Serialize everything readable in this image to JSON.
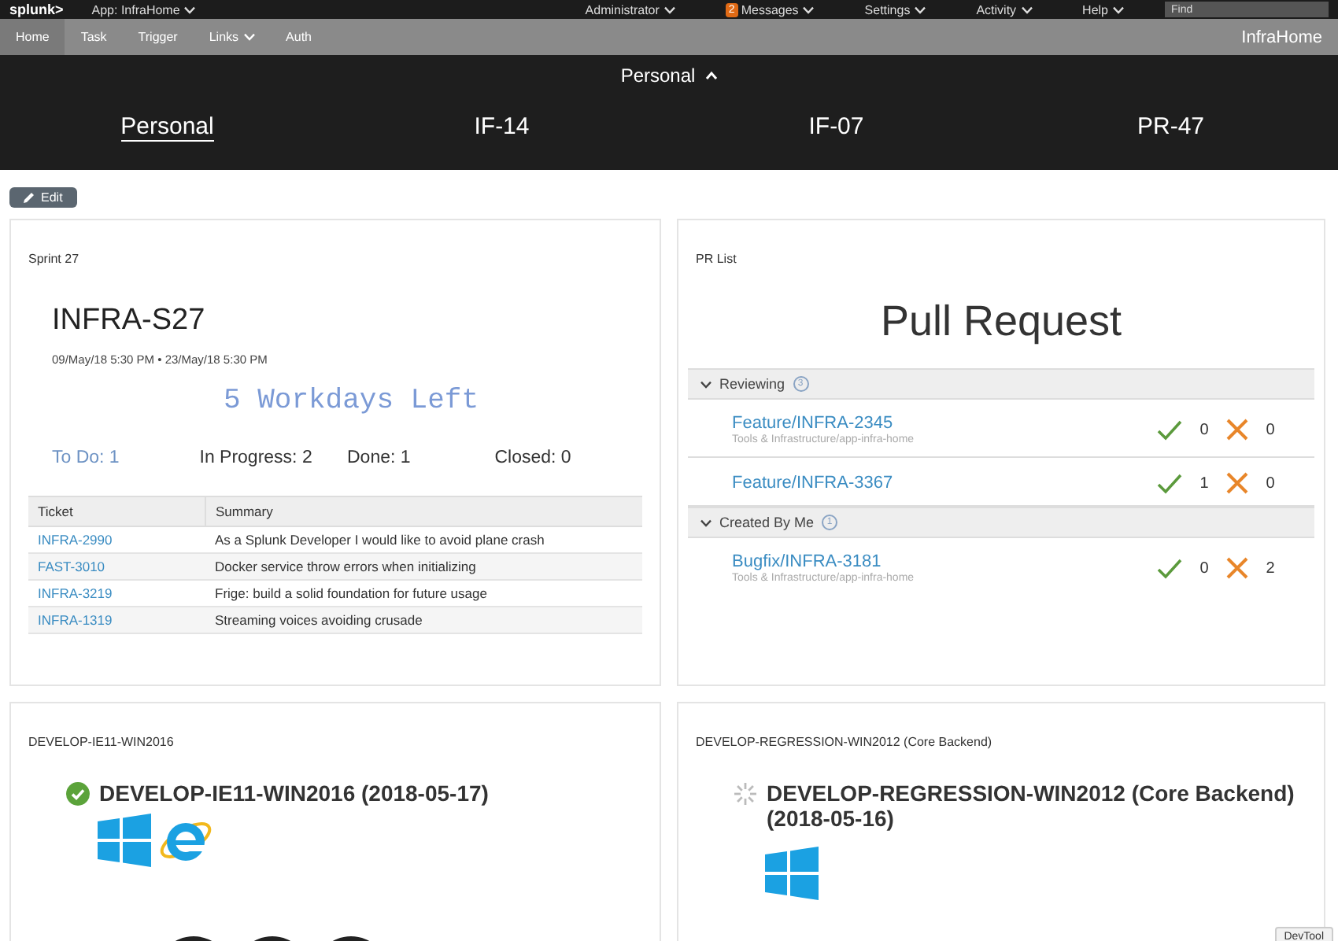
{
  "top_bar": {
    "logo": "splunk>",
    "app": {
      "label": "App: InfraHome",
      "dropdown": true
    },
    "menus": [
      {
        "label": "Administrator"
      },
      {
        "label": "Messages",
        "badge": "2"
      },
      {
        "label": "Settings"
      },
      {
        "label": "Activity"
      },
      {
        "label": "Help"
      }
    ],
    "search": {
      "placeholder": "Find"
    }
  },
  "app_bar": {
    "items": [
      {
        "label": "Home",
        "selected": true,
        "dropdown": false
      },
      {
        "label": "Task",
        "selected": false,
        "dropdown": false
      },
      {
        "label": "Trigger",
        "selected": false,
        "dropdown": false
      },
      {
        "label": "Links",
        "selected": false,
        "dropdown": true
      },
      {
        "label": "Auth",
        "selected": false,
        "dropdown": false
      }
    ],
    "app_title": "InfraHome"
  },
  "header": {
    "title": "Personal",
    "expanded": true,
    "tabs": [
      {
        "label": "Personal",
        "selected": true
      },
      {
        "label": "IF-14",
        "selected": false
      },
      {
        "label": "IF-07",
        "selected": false
      },
      {
        "label": "PR-47",
        "selected": false
      }
    ]
  },
  "edit_button": "Edit",
  "sprint": {
    "panel_title": "Sprint 27",
    "name": "INFRA-S27",
    "dates": "09/May/18 5:30 PM • 23/May/18 5:30 PM",
    "remaining": "5 Workdays Left",
    "counts": [
      {
        "label": "To Do: 1",
        "hovered": true
      },
      {
        "label": "In Progress: 2",
        "hovered": false
      },
      {
        "label": "Done: 1",
        "hovered": false
      },
      {
        "label": "Closed: 0",
        "hovered": false
      }
    ],
    "table": {
      "columns": [
        "Ticket",
        "Summary"
      ],
      "rows": [
        [
          "INFRA-2990",
          "As a Splunk Developer I would like to avoid plane crash"
        ],
        [
          "FAST-3010",
          "Docker service throw errors when initializing"
        ],
        [
          "INFRA-3219",
          "Frige: build a solid foundation for future usage"
        ],
        [
          "INFRA-1319",
          "Streaming voices avoiding crusade"
        ]
      ]
    }
  },
  "pr_list": {
    "panel_title": "PR List",
    "title": "Pull Request",
    "groups": [
      {
        "label": "Reviewing",
        "count": "3",
        "expanded": true,
        "items": [
          {
            "title": "Feature/INFRA-2345",
            "subtitle": "Tools & Infrastructure/app-infra-home",
            "approvals": "0",
            "rejections": "0"
          },
          {
            "title": "Feature/INFRA-3367",
            "approvals": "1",
            "rejections": "0"
          }
        ]
      },
      {
        "label": "Created By Me",
        "count": "1",
        "expanded": true,
        "items": [
          {
            "title": "Bugfix/INFRA-3181",
            "subtitle": "Tools & Infrastructure/app-infra-home",
            "approvals": "0",
            "rejections": "2"
          }
        ]
      }
    ]
  },
  "builds": [
    {
      "panel_title": "DEVELOP-IE11-WIN2016",
      "title": "DEVELOP-IE11-WIN2016 (2018-05-17)",
      "kind": "passed",
      "ie_logo": true
    },
    {
      "panel_title": "DEVELOP-REGRESSION-WIN2012 (Core Backend)",
      "title": "DEVELOP-REGRESSION-WIN2012 (Core Backend) (2018-05-16)",
      "kind": "running",
      "ie_logo": false
    }
  ],
  "devtool_button": "DevTool"
}
